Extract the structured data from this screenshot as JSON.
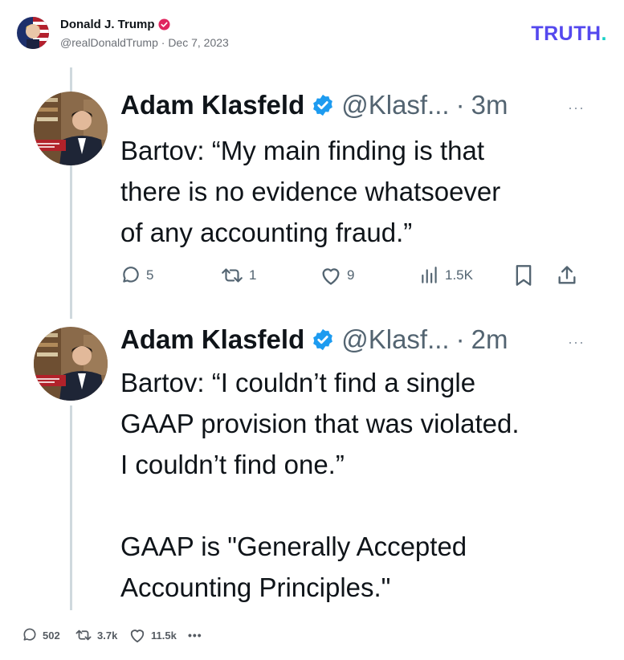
{
  "post": {
    "author_name": "Donald J. Trump",
    "author_handle": "@realDonaldTrump",
    "separator": "·",
    "date": "Dec 7, 2023",
    "brand_logo": "TRUTH",
    "brand_logo_dot": ".",
    "colors": {
      "brand": "#5448ee",
      "brand_dot": "#17d1c6",
      "verified_badge": "#e0245e"
    }
  },
  "embedded_thread": [
    {
      "name": "Adam Klasfeld",
      "handle": "@Klasf...",
      "sep": "·",
      "time": "3m",
      "more": "···",
      "text": "Bartov: “My main finding is that\nthere is no evidence whatsoever\nof any accounting fraud.”",
      "stats": {
        "replies": "5",
        "reposts": "1",
        "likes": "9",
        "views": "1.5K"
      }
    },
    {
      "name": "Adam Klasfeld",
      "handle": "@Klasf...",
      "sep": "·",
      "time": "2m",
      "more": "···",
      "text": "Bartov: “I couldn’t find a single\nGAAP provision that was violated.\nI couldn’t find one.”\n\nGAAP is \"Generally Accepted\nAccounting Principles.\""
    }
  ],
  "footer": {
    "replies": "502",
    "retruths": "3.7k",
    "likes": "11.5k",
    "more": "•••"
  }
}
